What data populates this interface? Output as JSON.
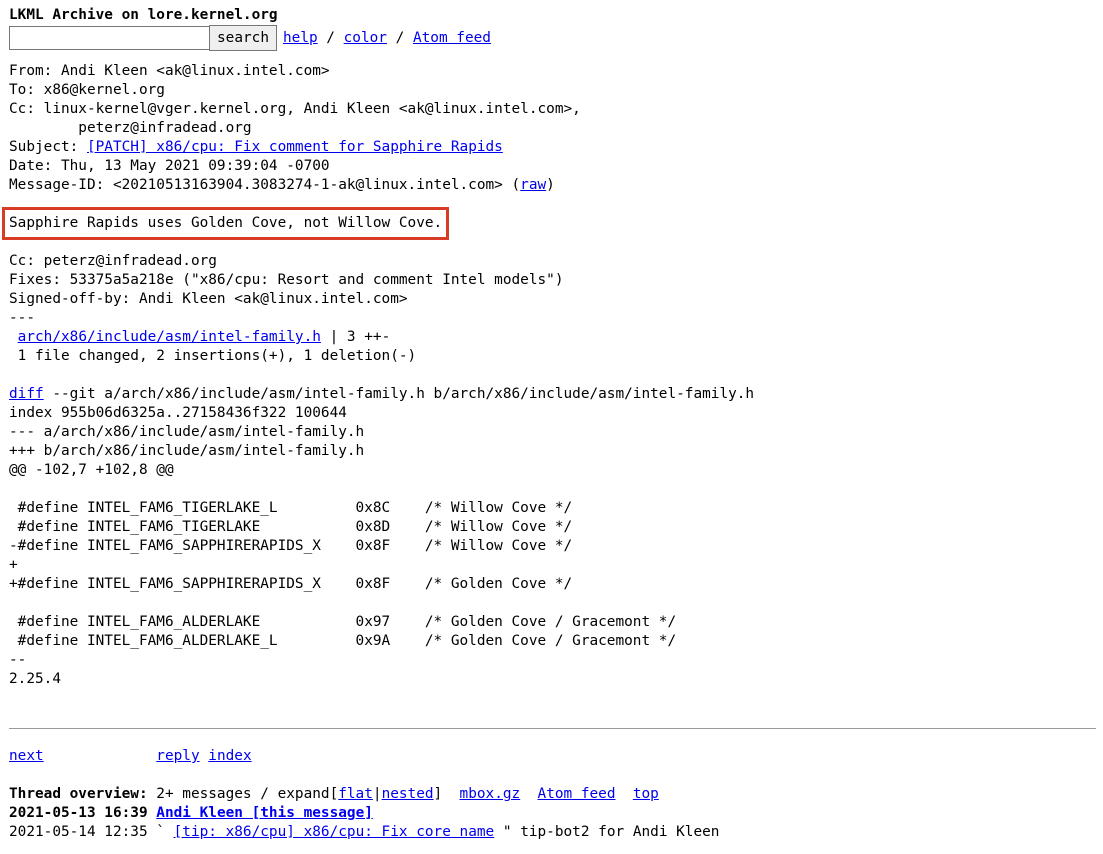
{
  "header": {
    "title": "LKML Archive on lore.kernel.org",
    "search_value": "",
    "search_button": "search",
    "links": [
      {
        "label": "help"
      },
      {
        "label": "color"
      },
      {
        "label": "Atom feed"
      }
    ],
    "sep": " / "
  },
  "headers": {
    "from": "From: Andi Kleen <ak@linux.intel.com>",
    "to": "To: x86@kernel.org",
    "cc1": "Cc: linux-kernel@vger.kernel.org, Andi Kleen <ak@linux.intel.com>,",
    "cc2": "        peterz@infradead.org",
    "subject_label": "Subject: ",
    "subject_link": "[PATCH] x86/cpu: Fix comment for Sapphire Rapids",
    "date": "Date: Thu, 13 May 2021 09:39:04 -0700",
    "msgid_prefix": "Message-ID: <20210513163904.3083274-1-ak@linux.intel.com> (",
    "raw_link": "raw",
    "msgid_suffix": ")"
  },
  "body": {
    "highlight": "Sapphire Rapids uses Golden Cove, not Willow Cove.",
    "cc": "Cc: peterz@infradead.org",
    "fixes": "Fixes: 53375a5a218e (\"x86/cpu: Resort and comment Intel models\")",
    "signed": "Signed-off-by: Andi Kleen <ak@linux.intel.com>",
    "dashes": "---",
    "stat_pre": " ",
    "stat_link": "arch/x86/include/asm/intel-family.h",
    "stat_post": " | 3 ++-",
    "summary": " 1 file changed, 2 insertions(+), 1 deletion(-)"
  },
  "diff": {
    "diff_link": "diff",
    "diff_rest": " --git a/arch/x86/include/asm/intel-family.h b/arch/x86/include/asm/intel-family.h",
    "index": "index 955b06d6325a..27158436f322 100644",
    "minus_file": "--- a/arch/x86/include/asm/intel-family.h",
    "plus_file": "+++ b/arch/x86/include/asm/intel-family.h",
    "hunk": "@@ -102,7 +102,8 @@",
    "lines": [
      "",
      " #define INTEL_FAM6_TIGERLAKE_L         0x8C    /* Willow Cove */",
      " #define INTEL_FAM6_TIGERLAKE           0x8D    /* Willow Cove */",
      "-#define INTEL_FAM6_SAPPHIRERAPIDS_X    0x8F    /* Willow Cove */",
      "+",
      "+#define INTEL_FAM6_SAPPHIRERAPIDS_X    0x8F    /* Golden Cove */",
      "",
      " #define INTEL_FAM6_ALDERLAKE           0x97    /* Golden Cove / Gracemont */",
      " #define INTEL_FAM6_ALDERLAKE_L         0x9A    /* Golden Cove / Gracemont */",
      "--",
      "2.25.4"
    ]
  },
  "footer": {
    "next": "next",
    "gap": "             ",
    "reply": "reply",
    "index": "index",
    "overview_label": "Thread overview:",
    "overview_text": " 2+ messages / expand[",
    "flat": "flat",
    "bar": "|",
    "nested": "nested",
    "close": "]  ",
    "mbox": "mbox.gz",
    "atom": "Atom feed",
    "top": "top",
    "t1_date": "2021-05-13 16:39",
    "t1_link": "Andi Kleen [this message]",
    "t2_date": "2021-05-14 12:35",
    "t2_mid": " ` ",
    "t2_link": "[tip: x86/cpu] x86/cpu: Fix core name",
    "t2_rest": " \" tip-bot2 for Andi Kleen"
  }
}
